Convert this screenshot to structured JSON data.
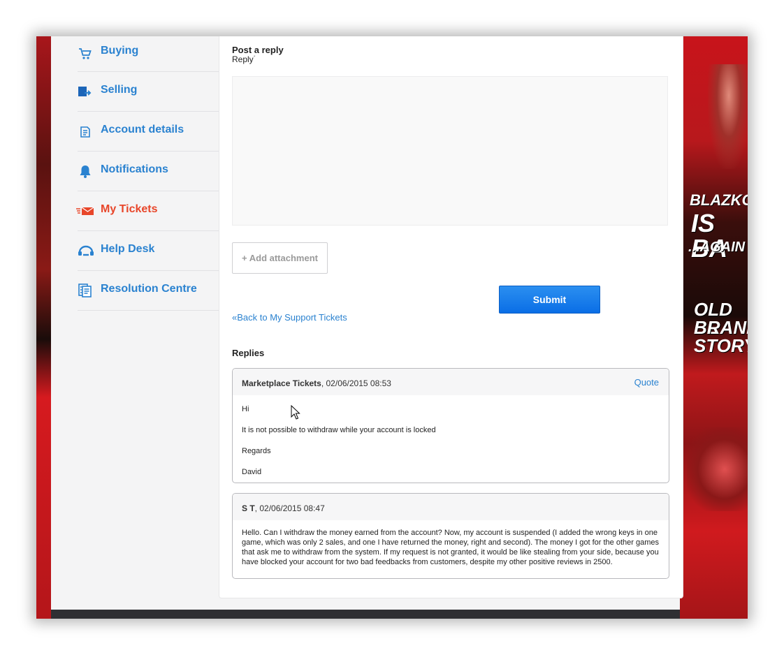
{
  "sidebar": {
    "items": [
      {
        "label": "Buying",
        "icon": "cart-icon"
      },
      {
        "label": "Selling",
        "icon": "selling-icon"
      },
      {
        "label": "Account details",
        "icon": "document-icon"
      },
      {
        "label": "Notifications",
        "icon": "bell-icon"
      },
      {
        "label": "My Tickets",
        "icon": "ticket-icon",
        "active": true
      },
      {
        "label": "Help Desk",
        "icon": "headset-icon"
      },
      {
        "label": "Resolution Centre",
        "icon": "clipboard-icon"
      }
    ]
  },
  "form": {
    "title": "Post a reply",
    "reply_label": "Reply",
    "required_mark": "*",
    "reply_value": "",
    "attach_label": "+ Add attachment",
    "submit_label": "Submit",
    "back_link": "«Back to My Support Tickets"
  },
  "replies": {
    "title": "Replies",
    "quote_label": "Quote",
    "items": [
      {
        "author": "Marketplace Tickets",
        "date": ", 02/06/2015 08:53",
        "lines": [
          "Hi",
          "It is not possible to withdraw while your account is locked",
          "Regards",
          "David"
        ]
      },
      {
        "author": "S T",
        "date": ", 02/06/2015 08:47",
        "text": "Hello. Can I withdraw the money earned from the account? Now, my account is suspended (I added the wrong keys in one game, which was only 2 sales, and one I have returned the money, right and second). The money I got for the other games that ask me to withdraw from the system. If my request is not granted, it would be like stealing from your side, because you have blocked your account for two bad feedbacks from customers, despite my other positive reviews in 2500."
      }
    ]
  },
  "promo": {
    "line1": "BLAZKOU",
    "line2": "IS BA",
    "line3": "...AGAIN",
    "line4": "OLD BL",
    "line5": "BRAND",
    "line6": "STORY!"
  },
  "colors": {
    "link": "#2a82d0",
    "active": "#e8462a",
    "submit": "#0a6ee6",
    "brand_red": "#c8141b"
  }
}
